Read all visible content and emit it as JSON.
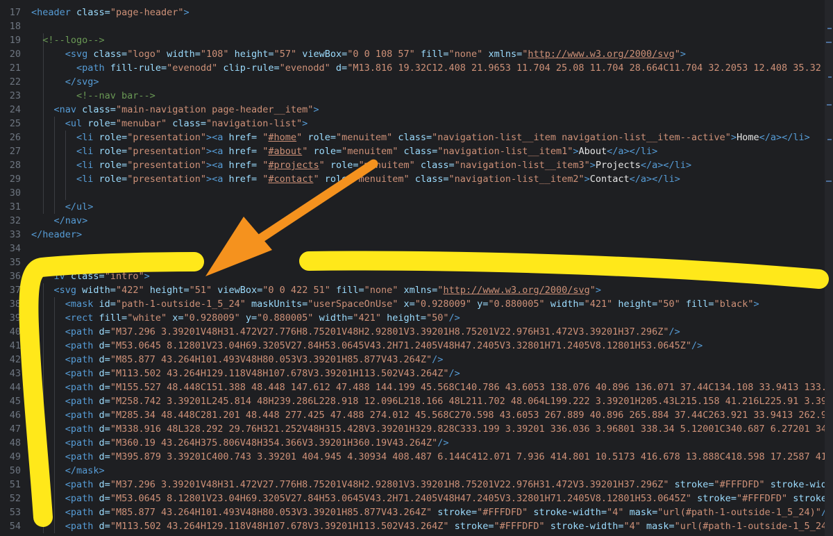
{
  "editor": {
    "lines": [
      {
        "n": "17",
        "s": [
          [
            "t",
            "<header "
          ],
          [
            "a",
            "class="
          ],
          [
            "v",
            "\"page-header\""
          ],
          [
            "t",
            ">"
          ]
        ]
      },
      {
        "n": "18",
        "s": []
      },
      {
        "n": "19",
        "s": [
          [
            "c",
            "  <!--logo-->"
          ]
        ]
      },
      {
        "n": "20",
        "s": [
          [
            "t",
            "      <svg "
          ],
          [
            "a",
            "class="
          ],
          [
            "v",
            "\"logo\" "
          ],
          [
            "a",
            "width="
          ],
          [
            "v",
            "\"108\" "
          ],
          [
            "a",
            "height="
          ],
          [
            "v",
            "\"57\" "
          ],
          [
            "a",
            "viewBox="
          ],
          [
            "v",
            "\"0 0 108 57\" "
          ],
          [
            "a",
            "fill="
          ],
          [
            "v",
            "\"none\" "
          ],
          [
            "a",
            "xmlns="
          ],
          [
            "v",
            "\""
          ],
          [
            "l",
            "http://www.w3.org/2000/svg"
          ],
          [
            "v",
            "\""
          ],
          [
            "t",
            ">"
          ]
        ]
      },
      {
        "n": "21",
        "s": [
          [
            "t",
            "        <path "
          ],
          [
            "a",
            "fill-rule="
          ],
          [
            "v",
            "\"evenodd\" "
          ],
          [
            "a",
            "clip-rule="
          ],
          [
            "v",
            "\"evenodd\" "
          ],
          [
            "a",
            "d="
          ],
          [
            "v",
            "\"M13.816 19.32C12.408 21.9653 11.704 25.08 11.704 28.664C11.704 32.2053 12.408 35.32"
          ]
        ]
      },
      {
        "n": "22",
        "s": [
          [
            "t",
            "      </svg>"
          ]
        ]
      },
      {
        "n": "23",
        "s": [
          [
            "c",
            "        <!--nav bar-->"
          ]
        ]
      },
      {
        "n": "24",
        "s": [
          [
            "t",
            "    <nav "
          ],
          [
            "a",
            "class="
          ],
          [
            "v",
            "\"main-navigation page-header__item\""
          ],
          [
            "t",
            ">"
          ]
        ]
      },
      {
        "n": "25",
        "s": [
          [
            "t",
            "      <ul "
          ],
          [
            "a",
            "role="
          ],
          [
            "v",
            "\"menubar\" "
          ],
          [
            "a",
            "class="
          ],
          [
            "v",
            "\"navigation-list\""
          ],
          [
            "t",
            ">"
          ]
        ]
      },
      {
        "n": "26",
        "s": [
          [
            "t",
            "        <li "
          ],
          [
            "a",
            "role="
          ],
          [
            "v",
            "\"presentation\""
          ],
          [
            "t",
            "><a "
          ],
          [
            "a",
            "href= "
          ],
          [
            "v",
            "\""
          ],
          [
            "l",
            "#home"
          ],
          [
            "v",
            "\" "
          ],
          [
            "a",
            "role="
          ],
          [
            "v",
            "\"menuitem\" "
          ],
          [
            "a",
            "class="
          ],
          [
            "v",
            "\"navigation-list__item navigation-list__item--active\""
          ],
          [
            "t",
            ">"
          ],
          [
            "x",
            "Home"
          ],
          [
            "t",
            "</a></li>"
          ]
        ]
      },
      {
        "n": "27",
        "s": [
          [
            "t",
            "        <li "
          ],
          [
            "a",
            "role="
          ],
          [
            "v",
            "\"presentation\""
          ],
          [
            "t",
            "><a "
          ],
          [
            "a",
            "href= "
          ],
          [
            "v",
            "\""
          ],
          [
            "l",
            "#about"
          ],
          [
            "v",
            "\" "
          ],
          [
            "a",
            "role="
          ],
          [
            "v",
            "\"menuitem\" "
          ],
          [
            "a",
            "class="
          ],
          [
            "v",
            "\"navigation-list__item1\""
          ],
          [
            "t",
            ">"
          ],
          [
            "x",
            "About"
          ],
          [
            "t",
            "</a></li>"
          ]
        ]
      },
      {
        "n": "28",
        "s": [
          [
            "t",
            "        <li "
          ],
          [
            "a",
            "role="
          ],
          [
            "v",
            "\"presentation\""
          ],
          [
            "t",
            "><a "
          ],
          [
            "a",
            "href= "
          ],
          [
            "v",
            "\""
          ],
          [
            "l",
            "#projects"
          ],
          [
            "v",
            "\" "
          ],
          [
            "a",
            "role="
          ],
          [
            "v",
            "\"menuitem\" "
          ],
          [
            "a",
            "class="
          ],
          [
            "v",
            "\"navigation-list__item3\""
          ],
          [
            "t",
            ">"
          ],
          [
            "x",
            "Projects"
          ],
          [
            "t",
            "</a></li>"
          ]
        ]
      },
      {
        "n": "29",
        "s": [
          [
            "t",
            "        <li "
          ],
          [
            "a",
            "role="
          ],
          [
            "v",
            "\"presentation\""
          ],
          [
            "t",
            "><a "
          ],
          [
            "a",
            "href= "
          ],
          [
            "v",
            "\""
          ],
          [
            "l",
            "#contact"
          ],
          [
            "v",
            "\" "
          ],
          [
            "a",
            "role="
          ],
          [
            "v",
            "\"menuitem\" "
          ],
          [
            "a",
            "class="
          ],
          [
            "v",
            "\"navigation-list__item2\""
          ],
          [
            "t",
            ">"
          ],
          [
            "x",
            "Contact"
          ],
          [
            "t",
            "</a></li>"
          ]
        ]
      },
      {
        "n": "30",
        "s": []
      },
      {
        "n": "31",
        "s": [
          [
            "t",
            "      </ul>"
          ]
        ]
      },
      {
        "n": "32",
        "s": [
          [
            "t",
            "    </nav>"
          ]
        ]
      },
      {
        "n": "33",
        "s": [
          [
            "t",
            "</header>"
          ]
        ]
      },
      {
        "n": "34",
        "s": []
      },
      {
        "n": "35",
        "s": []
      },
      {
        "n": "36",
        "s": [
          [
            "t",
            "    iv "
          ],
          [
            "a",
            "class="
          ],
          [
            "v",
            "\"intro\""
          ],
          [
            "t",
            ">"
          ]
        ]
      },
      {
        "n": "37",
        "s": [
          [
            "t",
            "    <svg "
          ],
          [
            "a",
            "width="
          ],
          [
            "v",
            "\"422\" "
          ],
          [
            "a",
            "height="
          ],
          [
            "v",
            "\"51\" "
          ],
          [
            "a",
            "viewBox="
          ],
          [
            "v",
            "\"0 0 422 51\" "
          ],
          [
            "a",
            "fill="
          ],
          [
            "v",
            "\"none\" "
          ],
          [
            "a",
            "xmlns="
          ],
          [
            "v",
            "\""
          ],
          [
            "l",
            "http://www.w3.org/2000/svg"
          ],
          [
            "v",
            "\""
          ],
          [
            "t",
            ">"
          ]
        ]
      },
      {
        "n": "38",
        "s": [
          [
            "t",
            "      <mask "
          ],
          [
            "a",
            "id="
          ],
          [
            "v",
            "\"path-1-outside-1_5_24\" "
          ],
          [
            "a",
            "maskUnits="
          ],
          [
            "v",
            "\"userSpaceOnUse\" "
          ],
          [
            "a",
            "x="
          ],
          [
            "v",
            "\"0.928009\" "
          ],
          [
            "a",
            "y="
          ],
          [
            "v",
            "\"0.880005\" "
          ],
          [
            "a",
            "width="
          ],
          [
            "v",
            "\"421\" "
          ],
          [
            "a",
            "height="
          ],
          [
            "v",
            "\"50\" "
          ],
          [
            "a",
            "fill="
          ],
          [
            "v",
            "\"black\""
          ],
          [
            "t",
            ">"
          ]
        ]
      },
      {
        "n": "39",
        "s": [
          [
            "t",
            "      <rect "
          ],
          [
            "a",
            "fill="
          ],
          [
            "v",
            "\"white\" "
          ],
          [
            "a",
            "x="
          ],
          [
            "v",
            "\"0.928009\" "
          ],
          [
            "a",
            "y="
          ],
          [
            "v",
            "\"0.880005\" "
          ],
          [
            "a",
            "width="
          ],
          [
            "v",
            "\"421\" "
          ],
          [
            "a",
            "height="
          ],
          [
            "v",
            "\"50\""
          ],
          [
            "t",
            "/>"
          ]
        ]
      },
      {
        "n": "40",
        "s": [
          [
            "t",
            "      <path "
          ],
          [
            "a",
            "d="
          ],
          [
            "v",
            "\"M37.296 3.39201V48H31.472V27.776H8.75201V48H2.92801V3.39201H8.75201V22.976H31.472V3.39201H37.296Z\""
          ],
          [
            "t",
            "/>"
          ]
        ]
      },
      {
        "n": "41",
        "s": [
          [
            "t",
            "      <path "
          ],
          [
            "a",
            "d="
          ],
          [
            "v",
            "\"M53.0645 8.12801V23.04H69.3205V27.84H53.0645V43.2H71.2405V48H47.2405V3.32801H71.2405V8.12801H53.0645Z\""
          ],
          [
            "t",
            "/>"
          ]
        ]
      },
      {
        "n": "42",
        "s": [
          [
            "t",
            "      <path "
          ],
          [
            "a",
            "d="
          ],
          [
            "v",
            "\"M85.877 43.264H101.493V48H80.053V3.39201H85.877V43.264Z\""
          ],
          [
            "t",
            "/>"
          ]
        ]
      },
      {
        "n": "43",
        "s": [
          [
            "t",
            "      <path "
          ],
          [
            "a",
            "d="
          ],
          [
            "v",
            "\"M113.502 43.264H129.118V48H107.678V3.39201H113.502V43.264Z\""
          ],
          [
            "t",
            "/>"
          ]
        ]
      },
      {
        "n": "44",
        "s": [
          [
            "t",
            "      <path "
          ],
          [
            "a",
            "d="
          ],
          [
            "v",
            "\"M155.527 48.448C151.388 48.448 147.612 47.488 144.199 45.568C140.786 43.6053 138.076 40.896 136.071 37.44C134.108 33.9413 133.1"
          ]
        ]
      },
      {
        "n": "45",
        "s": [
          [
            "t",
            "      <path "
          ],
          [
            "a",
            "d="
          ],
          [
            "v",
            "\"M258.742 3.39201L245.814 48H239.286L228.918 12.096L218.166 48L211.702 48.064L199.222 3.39201H205.43L215.158 41.216L225.91 3.3920"
          ]
        ]
      },
      {
        "n": "46",
        "s": [
          [
            "t",
            "      <path "
          ],
          [
            "a",
            "d="
          ],
          [
            "v",
            "\"M285.34 48.448C281.201 48.448 277.425 47.488 274.012 45.568C270.598 43.6053 267.889 40.896 265.884 37.44C263.921 33.9413 262.94"
          ]
        ]
      },
      {
        "n": "47",
        "s": [
          [
            "t",
            "      <path "
          ],
          [
            "a",
            "d="
          ],
          [
            "v",
            "\"M338.916 48L328.292 29.76H321.252V48H315.428V3.39201H329.828C333.199 3.39201 336.036 3.96801 338.34 5.12001C340.687 6.27201 342."
          ]
        ]
      },
      {
        "n": "48",
        "s": [
          [
            "t",
            "      <path "
          ],
          [
            "a",
            "d="
          ],
          [
            "v",
            "\"M360.19 43.264H375.806V48H354.366V3.39201H360.19V43.264Z\""
          ],
          [
            "t",
            "/>"
          ]
        ]
      },
      {
        "n": "49",
        "s": [
          [
            "t",
            "      <path "
          ],
          [
            "a",
            "d="
          ],
          [
            "v",
            "\"M395.879 3.39201C400.743 3.39201 404.945 4.30934 408.487 6.144C412.071 7.936 414.801 10.5173 416.678 13.888C418.598 17.2587 419."
          ]
        ]
      },
      {
        "n": "50",
        "s": [
          [
            "t",
            "      </mask>"
          ]
        ]
      },
      {
        "n": "51",
        "s": [
          [
            "t",
            "      <path "
          ],
          [
            "a",
            "d="
          ],
          [
            "v",
            "\"M37.296 3.39201V48H31.472V27.776H8.75201V48H2.92801V3.39201H8.75201V22.976H31.472V3.39201H37.296Z\" "
          ],
          [
            "a",
            "stroke="
          ],
          [
            "v",
            "\"#FFFDFD\" "
          ],
          [
            "a",
            "stroke-width"
          ]
        ]
      },
      {
        "n": "52",
        "s": [
          [
            "t",
            "      <path "
          ],
          [
            "a",
            "d="
          ],
          [
            "v",
            "\"M53.0645 8.12801V23.04H69.3205V27.84H53.0645V43.2H71.2405V48H47.2405V3.32801H71.2405V8.12801H53.0645Z\" "
          ],
          [
            "a",
            "stroke="
          ],
          [
            "v",
            "\"#FFFDFD\" "
          ],
          [
            "a",
            "stroke-w"
          ]
        ]
      },
      {
        "n": "53",
        "s": [
          [
            "t",
            "      <path "
          ],
          [
            "a",
            "d="
          ],
          [
            "v",
            "\"M85.877 43.264H101.493V48H80.053V3.39201H85.877V43.264Z\" "
          ],
          [
            "a",
            "stroke="
          ],
          [
            "v",
            "\"#FFFDFD\" "
          ],
          [
            "a",
            "stroke-width="
          ],
          [
            "v",
            "\"4\" "
          ],
          [
            "a",
            "mask="
          ],
          [
            "v",
            "\"url(#path-1-outside-1_5_24)\""
          ],
          [
            "t",
            "/>"
          ]
        ]
      },
      {
        "n": "54",
        "s": [
          [
            "t",
            "      <path "
          ],
          [
            "a",
            "d="
          ],
          [
            "v",
            "\"M113.502 43.264H129.118V48H107.678V3.39201H113.502V43.264Z\" "
          ],
          [
            "a",
            "stroke="
          ],
          [
            "v",
            "\"#FFFDFD\" "
          ],
          [
            "a",
            "stroke-width="
          ],
          [
            "v",
            "\"4\" "
          ],
          [
            "a",
            "mask="
          ],
          [
            "v",
            "\"url(#path-1-outside-1_5_24)\""
          ],
          [
            "t",
            "/>"
          ]
        ]
      }
    ]
  },
  "colors": {
    "highlight": "#ffe81a",
    "arrow": "#f5921e",
    "tag": "#569cd6",
    "attribute": "#9cdcfe",
    "value": "#ce9178",
    "comment": "#6a9955"
  },
  "icons": {
    "arrow": "arrow-annotation-icon"
  }
}
